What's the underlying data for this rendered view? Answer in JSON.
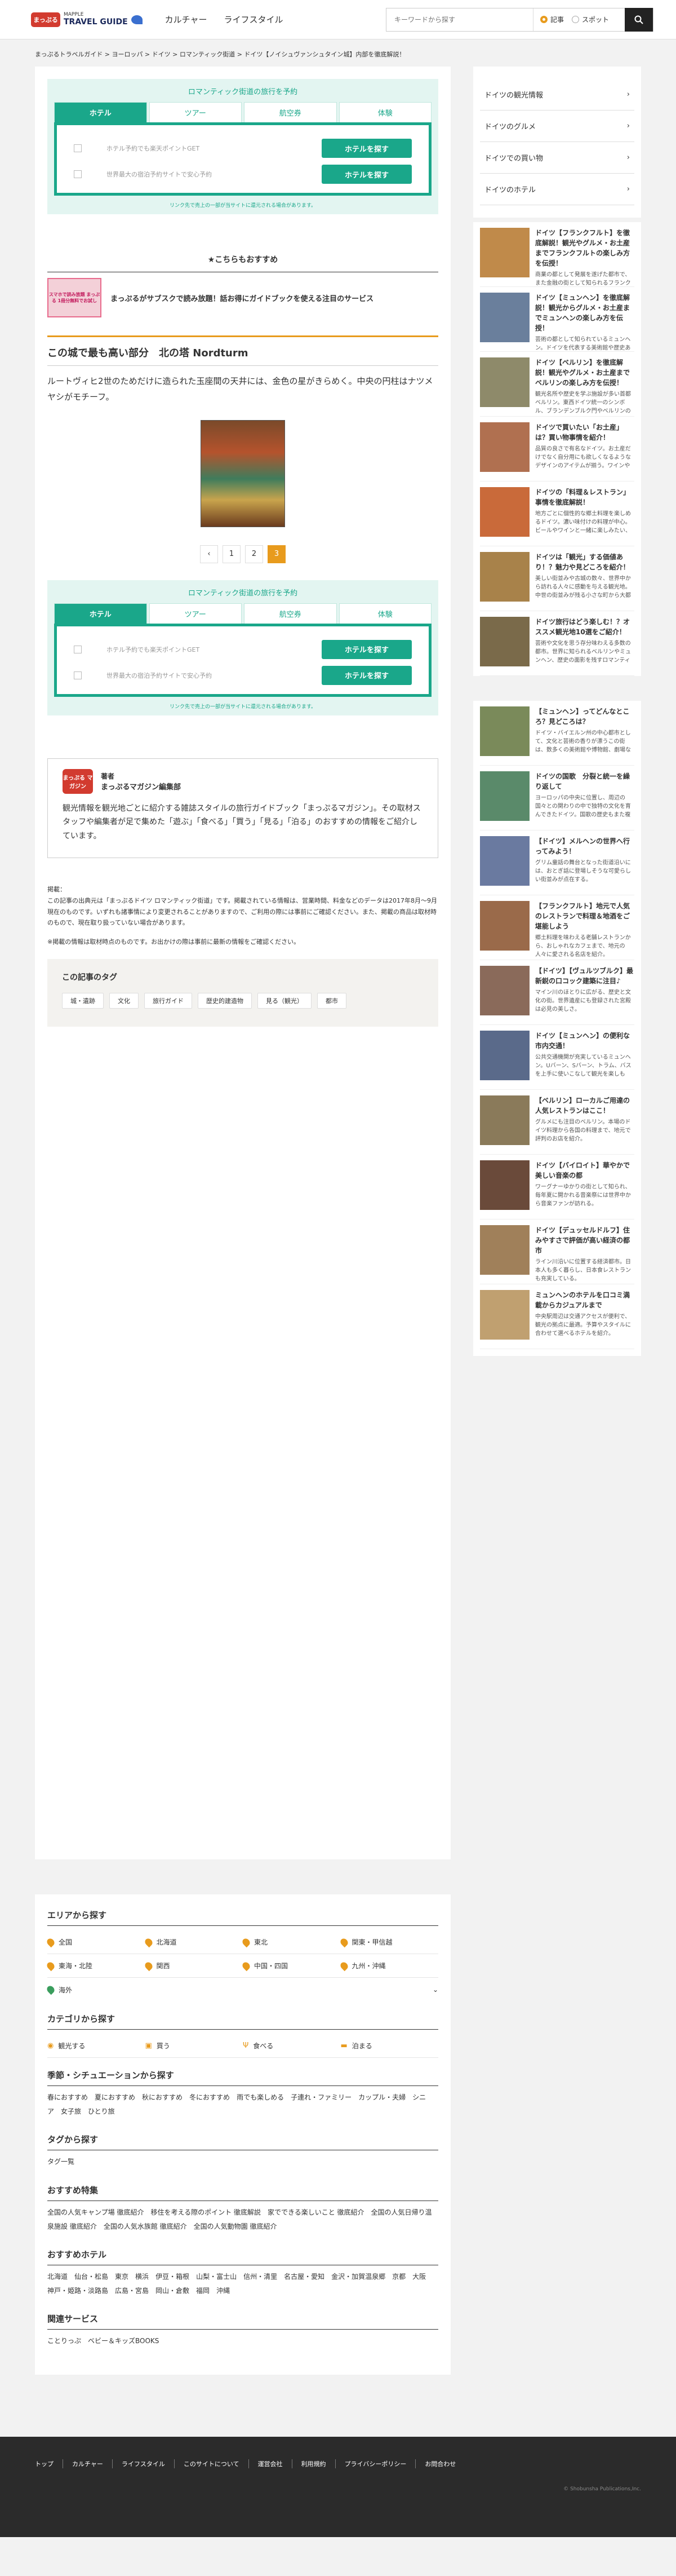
{
  "header": {
    "logo_mark": "まっぷる",
    "logo_small": "MAPPLE",
    "logo_text": "TRAVEL GUIDE",
    "nav": [
      "カルチャー",
      "ライフスタイル"
    ],
    "search_placeholder": "キーワードから探す",
    "radio_article": "記事",
    "radio_spot": "スポット"
  },
  "breadcrumb": "まっぷるトラベルガイド > ヨーロッパ > ドイツ > ロマンティック街道 > ドイツ【ノイシュヴァンシュタイン城】内部を徹底解説！",
  "promo": {
    "title": "ロマンティック街道の旅行を予約",
    "tabs": [
      "ホテル",
      "ツアー",
      "航空券",
      "体験"
    ],
    "rows": [
      {
        "text": "ホテル予約でも楽天ポイントGET",
        "button": "ホテルを探す"
      },
      {
        "text": "世界最大の宿泊予約サイトで安心予約",
        "button": "ホテルを探す"
      }
    ],
    "note": "リンク先で売上の一部が当サイトに還元される場合があります。"
  },
  "recommend": {
    "title": "★こちらもおすすめ",
    "thumb_text": "スマホで読み放題 まっぷる 1冊分無料でお試し",
    "text": "まっぷるがサブスクで読み放題！話お得にガイドブックを使える注目のサービス"
  },
  "article": {
    "heading": "この城で最も高い部分　北の塔 Nordturm",
    "body": "ルートヴィヒ2世のためだけに造られた玉座間の天井には、金色の星がきらめく。中央の円柱はナツメヤシがモチーフ。"
  },
  "pager": {
    "prev": "‹",
    "pages": [
      "1",
      "2",
      "3"
    ],
    "current": "3"
  },
  "author": {
    "logo": "まっぷる マガジン",
    "label": "著者",
    "name": "まっぷるマガジン編集部",
    "desc": "観光情報を観光地ごとに紹介する雑誌スタイルの旅行ガイドブック「まっぷるマガジン」。その取材スタッフや編集者が足で集めた「遊ぶ」「食べる」「買う」「見る」「泊る」のおすすめの情報をご紹介しています。"
  },
  "notes": [
    "掲載：",
    "この記事の出典元は「まっぷるドイツ ロマンティック街道」です。掲載されている情報は、営業時間、料金などのデータは2017年8月〜9月現在のものです。いずれも諸事情により変更されることがありますので、ご利用の際には事前にご確認ください。また、掲載の商品は取材時のもので、現在取り扱っていない場合があります。",
    "※掲載の情報は取材時点のものです。お出かけの際は事前に最新の情報をご確認ください。"
  ],
  "tags": {
    "title": "この記事のタグ",
    "items": [
      "城・遺跡",
      "文化",
      "旅行ガイド",
      "歴史的建造物",
      "見る（観光）",
      "都市"
    ]
  },
  "side_menu": [
    "ドイツの観光情報",
    "ドイツのグルメ",
    "ドイツでの買い物",
    "ドイツのホテル"
  ],
  "side_articles_1": [
    {
      "title": "ドイツ【フランクフルト】を徹底解説！観光やグルメ・お土産までフランクフルトの楽しみ方を伝授！",
      "desc": "商業の都として発展を遂げた都市で、また金融の街として知られるフランクフルト。マインの出資のヘフナートヴァーへから数多の観察施設。"
    },
    {
      "title": "ドイツ【ミュンヘン】を徹底解説！観光からグルメ・お土産までミュンヘンの楽しみ方を伝授！",
      "desc": "芸術の都として知られているミュンヘン。ドイツを代表する美術館や歴史ある建造物が多数。名所にあるビアホールも楽しめる。"
    },
    {
      "title": "ドイツ【ベルリン】を徹底解説！観光やグルメ・お土産までベルリンの楽しみ方を伝授！",
      "desc": "観光名所や歴史を学ぶ施設が多い首都ベルリン。東西ドイツ統一のシンボル、ブランデンブルク門やベルリンの壁、東ドイツの歴史を…"
    },
    {
      "title": "ドイツで買いたい「お土産」は？買い物事情を紹介！",
      "desc": "品質の良さで有名なドイツ。お土産だけでなく自分用にも欲しくなるようなデザインのアイテムが揃う。ワインやチーズなどの食品も…"
    },
    {
      "title": "ドイツの「料理＆レストラン」事情を徹底解説！",
      "desc": "地方ごとに個性的な郷土料理を楽しめるドイツ。濃い味付けの料理が中心。ビールやワインと一緒に楽しみたい、伝統料理を紹介。"
    },
    {
      "title": "ドイツは「観光」する価値あり！？魅力や見どころを紹介！",
      "desc": "美しい街並みや古城の数々、世界中から訪れる人々に感動を与える観光地。中世の街並みが残る小さな町から大都市まで魅力的な旅先…"
    },
    {
      "title": "ドイツ旅行はどう楽しむ！？オススメ観光地10選をご紹介！",
      "desc": "芸術や文化を思う存分味わえる多数の都市。世界に知られるベルリンやミュンヘン、歴史の面影を残すロマンティック街道など…"
    }
  ],
  "side_articles_2": [
    {
      "title": "【ミュンヘン】ってどんなところ？見どころは？",
      "desc": "ドイツ・バイエルン州の中心都市として、文化と芸術の香りが漂うこの街は、数多くの美術館や博物館、劇場などで溢れている。"
    },
    {
      "title": "ドイツの国歌　分裂と統一を繰り返して",
      "desc": "ヨーロッパの中央に位置し、周辺の国々との関わりの中で独特の文化を育んできたドイツ。国歌の歴史もまた複雑だ。"
    },
    {
      "title": "【ドイツ】メルヘンの世界へ行ってみよう！",
      "desc": "グリム童話の舞台となった街道沿いには、おとぎ話に登場しそうな可愛らしい街並みが点在する。"
    },
    {
      "title": "【フランクフルト】地元で人気のレストランで料理＆地酒をご堪能しよう",
      "desc": "郷土料理を味わえる老舗レストランから、おしゃれなカフェまで、地元の人々に愛される名店を紹介。"
    },
    {
      "title": "【ドイツ】【ヴュルツブルク】最新鋭の口コック建築に注目♪",
      "desc": "マイン川のほとりに広がる、歴史と文化の街。世界遺産にも登録された宮殿は必見の美しさ。"
    },
    {
      "title": "ドイツ【ミュンヘン】の便利な市内交通！",
      "desc": "公共交通機関が充実しているミュンヘン。Uバーン、Sバーン、トラム、バスを上手に使いこなして観光を楽しもう。"
    },
    {
      "title": "【ベルリン】ローカルご用達の人気レストランはここ！",
      "desc": "グルメにも注目のベルリン。本場のドイツ料理から各国の料理まで、地元で評判のお店を紹介。"
    },
    {
      "title": "ドイツ【バイロイト】華やかで美しい音楽の都",
      "desc": "ワーグナーゆかりの街として知られ、毎年夏に開かれる音楽祭には世界中から音楽ファンが訪れる。"
    },
    {
      "title": "ドイツ【デュッセルドルフ】住みやすさで評価が高い経済の都市",
      "desc": "ライン川沿いに位置する経済都市。日本人も多く暮らし、日本食レストランも充実している。"
    },
    {
      "title": "ミュンヘンのホテルを口コミ満載からカジュアルまで",
      "desc": "中央駅周辺は交通アクセスが便利で、観光の拠点に最適。予算やスタイルに合わせて選べるホテルを紹介。"
    }
  ],
  "footer_search": {
    "area_title": "エリアから探す",
    "areas": [
      "全国",
      "北海道",
      "東北",
      "関東・甲信越",
      "東海・北陸",
      "関西",
      "中国・四国",
      "九州・沖縄"
    ],
    "overseas": "海外",
    "category_title": "カテゴリから探す",
    "categories": [
      "観光する",
      "買う",
      "食べる",
      "泊まる"
    ],
    "season_title": "季節・シチュエーションから探す",
    "seasons": [
      "春におすすめ",
      "夏におすすめ",
      "秋におすすめ",
      "冬におすすめ",
      "雨でも楽しめる",
      "子連れ・ファミリー",
      "カップル・夫婦",
      "シニア",
      "女子旅",
      "ひとり旅"
    ],
    "tag_title": "タグから探す",
    "tag_link": "タグ一覧",
    "feature_title": "おすすめ特集",
    "features": [
      "全国の人気キャンプ場 徹底紹介",
      "移住を考える際のポイント 徹底解説",
      "家でできる楽しいこと 徹底紹介",
      "全国の人気日帰り温泉施設 徹底紹介",
      "全国の人気水族館 徹底紹介",
      "全国の人気動物園 徹底紹介"
    ],
    "hotel_title": "おすすめホテル",
    "hotels": [
      "北海道",
      "仙台・松島",
      "東京",
      "横浜",
      "伊豆・箱根",
      "山梨・富士山",
      "信州・清里",
      "名古屋・愛知",
      "金沢・加賀温泉郷",
      "京都",
      "大阪",
      "神戸・姫路・淡路島",
      "広島・宮島",
      "岡山・倉敷",
      "福岡",
      "沖縄"
    ],
    "related_title": "関連サービス",
    "related": [
      "ことりっぷ",
      "ベビー＆キッズBOOKS"
    ]
  },
  "footer": {
    "links": [
      "トップ",
      "カルチャー",
      "ライフスタイル",
      "このサイトについて",
      "運営会社",
      "利用規約",
      "プライバシーポリシー",
      "お問合わせ"
    ],
    "copyright": "© Shobunsha Publications,Inc."
  }
}
